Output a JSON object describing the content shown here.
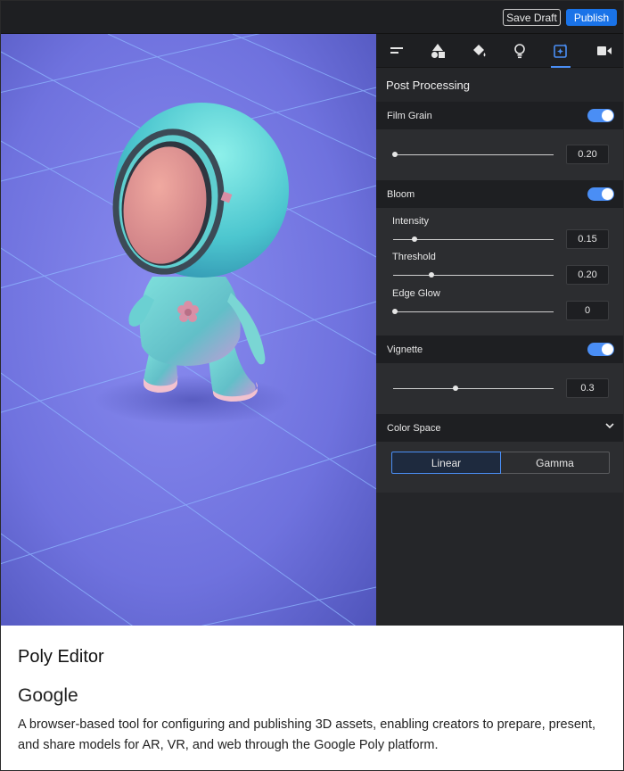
{
  "topbar": {
    "save_draft_label": "Save Draft",
    "publish_label": "Publish",
    "accent_color": "#1a73e8"
  },
  "viewport": {
    "content": "3D model on grid floor"
  },
  "toolbar_tabs": [
    {
      "icon": "align-left-icon",
      "active": false
    },
    {
      "icon": "shapes-icon",
      "active": false
    },
    {
      "icon": "paint-bucket-icon",
      "active": false
    },
    {
      "icon": "lightbulb-icon",
      "active": false
    },
    {
      "icon": "sparkle-image-icon",
      "active": true
    },
    {
      "icon": "video-camera-icon",
      "active": false
    }
  ],
  "panel": {
    "title": "Post Processing",
    "film_grain": {
      "label": "Film Grain",
      "enabled": true,
      "value": "0.20",
      "level": 0.0
    },
    "bloom": {
      "label": "Bloom",
      "enabled": true,
      "intensity": {
        "label": "Intensity",
        "value": "0.15",
        "level": 0.15
      },
      "threshold": {
        "label": "Threshold",
        "value": "0.20",
        "level": 0.24
      },
      "edge_glow": {
        "label": "Edge Glow",
        "value": "0",
        "level": 0.0
      }
    },
    "vignette": {
      "label": "Vignette",
      "enabled": true,
      "value": "0.3",
      "level": 0.39
    },
    "color_space": {
      "label": "Color Space",
      "options": [
        "Linear",
        "Gamma"
      ],
      "selected": "Linear"
    },
    "accent_color": "#4a8ef5"
  },
  "caption": {
    "app_name": "Poly Editor",
    "company": "Google",
    "description": "A browser-based tool for configuring and publishing 3D assets, enabling creators to prepare, present, and share models for AR, VR, and web through the Google Poly platform."
  }
}
